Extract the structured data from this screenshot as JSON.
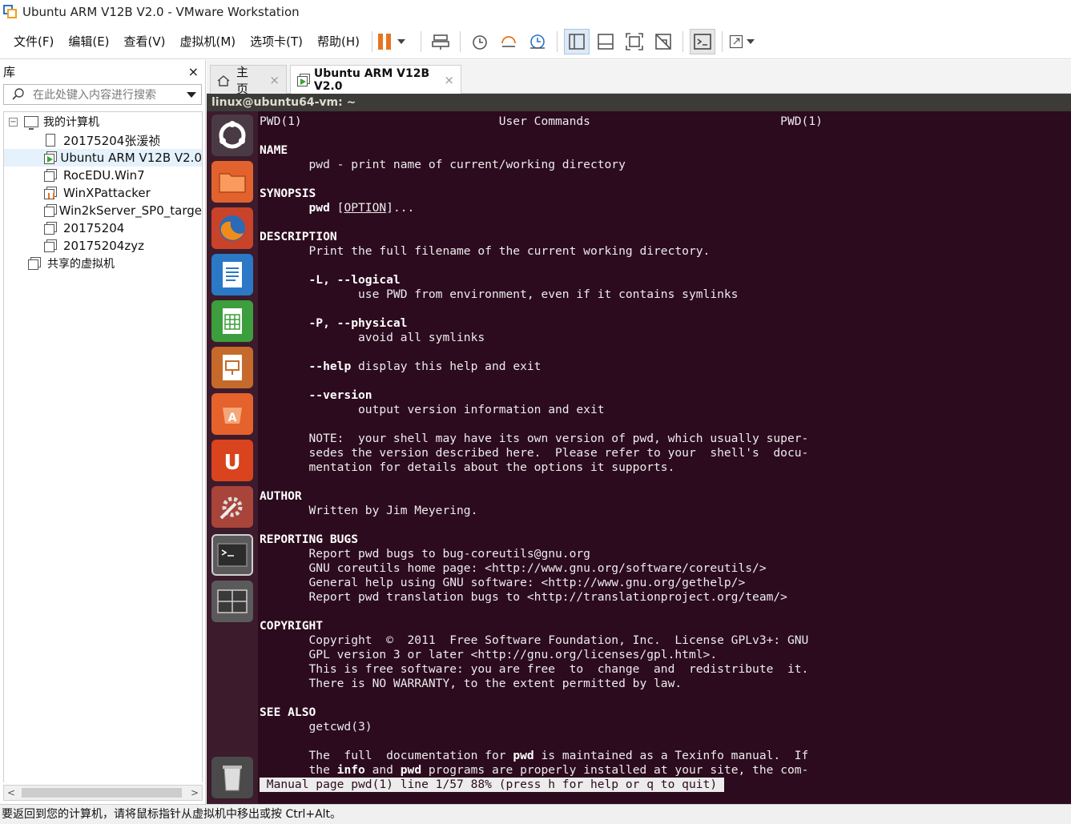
{
  "window": {
    "title": "Ubuntu ARM V12B V2.0 - VMware Workstation"
  },
  "menu": [
    "文件(F)",
    "编辑(E)",
    "查看(V)",
    "虚拟机(M)",
    "选项卡(T)",
    "帮助(H)"
  ],
  "toolbar_icons": [
    "pause-icon",
    "send-ctrl-alt-del-icon",
    "snapshot-icon",
    "revert-snapshot-icon",
    "snapshot-manager-icon",
    "library-view-icon",
    "thumbnail-view-icon",
    "fullscreen-icon",
    "unity-icon",
    "console-icon",
    "stretch-icon"
  ],
  "library": {
    "title": "库",
    "close": "×",
    "search_placeholder": "在此处键入内容进行搜索",
    "root": "我的计算机",
    "items": [
      "20175204张湲祯",
      "Ubuntu ARM V12B V2.0",
      "RocEDU.Win7",
      "WinXPattacker",
      "Win2kServer_SP0_targe",
      "20175204",
      "20175204zyz"
    ],
    "shared": "共享的虚拟机",
    "scroll_left": "<",
    "scroll_right": ">"
  },
  "tabs": [
    {
      "label": "主页",
      "close": "×"
    },
    {
      "label": "Ubuntu ARM V12B V2.0",
      "close": "×"
    }
  ],
  "terminal": {
    "title": "linux@ubuntu64-vm: ~",
    "lines": [
      {
        "t": "PWD(1)                            User Commands                           PWD(1)"
      },
      {
        "t": ""
      },
      {
        "t": "NAME",
        "bold": true
      },
      {
        "t": "       pwd - print name of current/working directory"
      },
      {
        "t": ""
      },
      {
        "t": "SYNOPSIS",
        "bold": true
      },
      {
        "t": "       pwd [OPTION]...",
        "html": "       <span class='b'>pwd</span> [<span class='u'>OPTION</span>]..."
      },
      {
        "t": ""
      },
      {
        "t": "DESCRIPTION",
        "bold": true
      },
      {
        "t": "       Print the full filename of the current working directory."
      },
      {
        "t": ""
      },
      {
        "t": "       -L, --logical",
        "bold": true
      },
      {
        "t": "              use PWD from environment, even if it contains symlinks"
      },
      {
        "t": ""
      },
      {
        "t": "       -P, --physical",
        "bold": true
      },
      {
        "t": "              avoid all symlinks"
      },
      {
        "t": ""
      },
      {
        "t": "       --help display this help and exit",
        "html": "       <span class='b'>--help</span> display this help and exit"
      },
      {
        "t": ""
      },
      {
        "t": "       --version",
        "bold": true
      },
      {
        "t": "              output version information and exit"
      },
      {
        "t": ""
      },
      {
        "t": "       NOTE:  your shell may have its own version of pwd, which usually super-"
      },
      {
        "t": "       sedes the version described here.  Please refer to your  shell's  docu-"
      },
      {
        "t": "       mentation for details about the options it supports."
      },
      {
        "t": ""
      },
      {
        "t": "AUTHOR",
        "bold": true
      },
      {
        "t": "       Written by Jim Meyering."
      },
      {
        "t": ""
      },
      {
        "t": "REPORTING BUGS",
        "bold": true
      },
      {
        "t": "       Report pwd bugs to bug-coreutils@gnu.org"
      },
      {
        "t": "       GNU coreutils home page: <http://www.gnu.org/software/coreutils/>"
      },
      {
        "t": "       General help using GNU software: <http://www.gnu.org/gethelp/>"
      },
      {
        "t": "       Report pwd translation bugs to <http://translationproject.org/team/>"
      },
      {
        "t": ""
      },
      {
        "t": "COPYRIGHT",
        "bold": true
      },
      {
        "t": "       Copyright  ©  2011  Free Software Foundation, Inc.  License GPLv3+: GNU"
      },
      {
        "t": "       GPL version 3 or later <http://gnu.org/licenses/gpl.html>."
      },
      {
        "t": "       This is free software: you are free  to  change  and  redistribute  it."
      },
      {
        "t": "       There is NO WARRANTY, to the extent permitted by law."
      },
      {
        "t": ""
      },
      {
        "t": "SEE ALSO",
        "bold": true
      },
      {
        "t": "       getcwd(3)"
      },
      {
        "t": ""
      },
      {
        "t": "       The  full  documentation for pwd is maintained as a Texinfo manual.  If",
        "html": "       The  full  documentation for <span class='b'>pwd</span> is maintained as a Texinfo manual.  If"
      },
      {
        "t": "       the info and pwd programs are properly installed at your site, the com-",
        "html": "       the <span class='b'>info</span> and <span class='b'>pwd</span> programs are properly installed at your site, the com-"
      }
    ],
    "status": " Manual page pwd(1) line 1/57 88% (press h for help or q to quit) "
  },
  "launcher_icons": [
    "ubuntu-dash-icon",
    "files-icon",
    "firefox-icon",
    "writer-icon",
    "calc-icon",
    "impress-icon",
    "software-center-icon",
    "ubuntu-one-icon",
    "system-settings-icon",
    "terminal-icon",
    "workspace-switcher-icon",
    "trash-icon"
  ],
  "statusbar": "要返回到您的计算机，请将鼠标指针从虚拟机中移出或按 Ctrl+Alt。"
}
